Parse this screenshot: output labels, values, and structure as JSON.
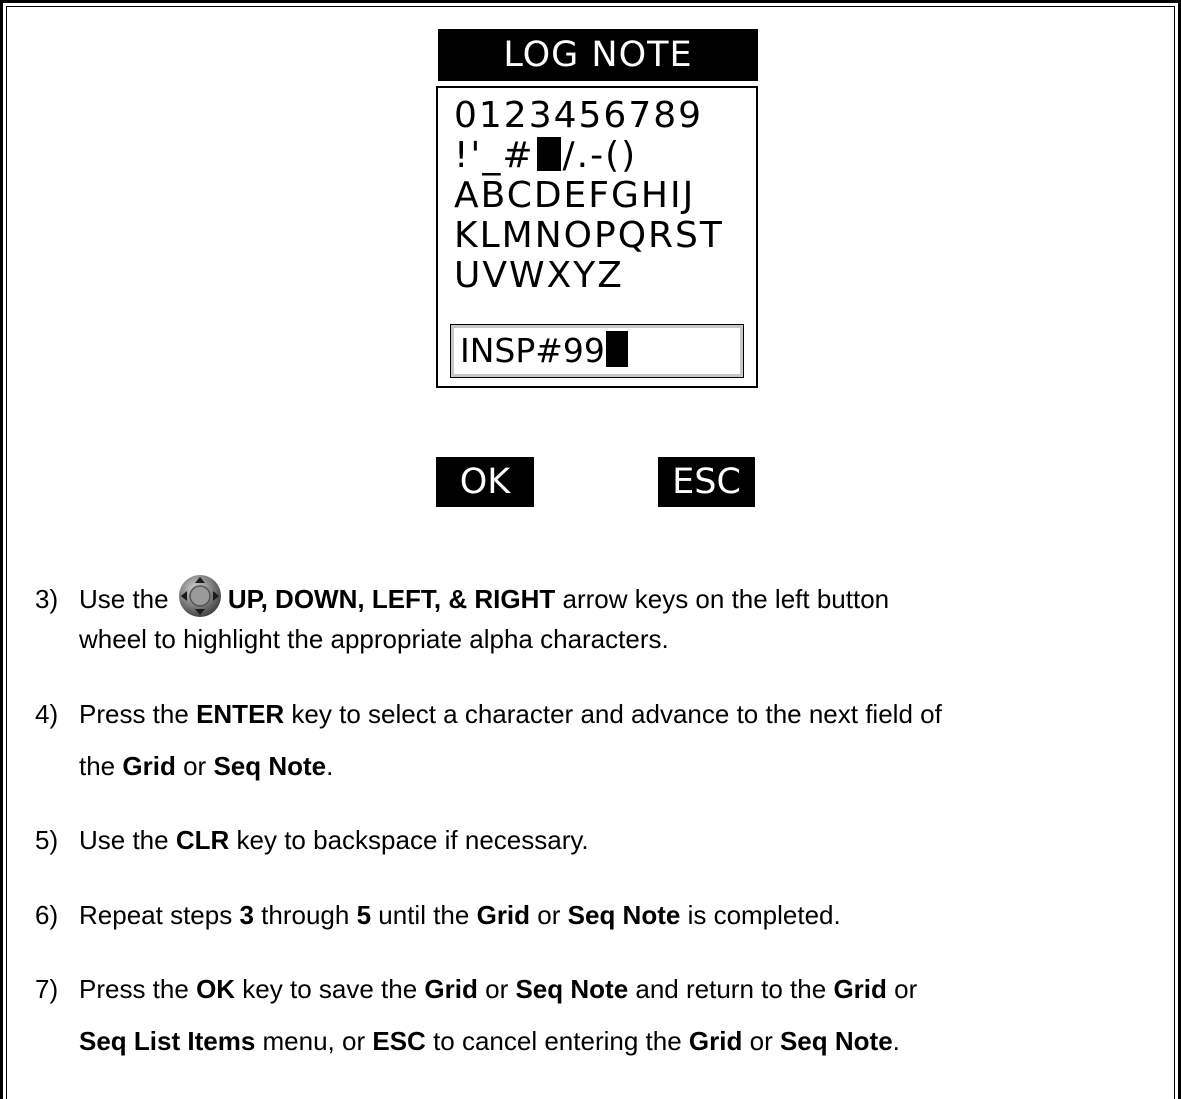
{
  "screen": {
    "title": "LOG NOTE",
    "rows": [
      "0123456789",
      "!'_#",
      "/.-()",
      "ABCDEFGHIJ",
      "KLMNOPQRST",
      "UVWXYZ"
    ],
    "note_value": "INSP#99",
    "ok_label": "OK",
    "esc_label": "ESC"
  },
  "steps": [
    {
      "num": "3)",
      "a": "Use the",
      "b": "UP, DOWN, LEFT, & RIGHT",
      "c": "arrow keys on the left button",
      "cont": "wheel to highlight the appropriate alpha characters."
    },
    {
      "num": "4)",
      "a": "Press the",
      "b": "ENTER",
      "c": "key to select a character and advance to the next field of",
      "cont_a": "the",
      "cont_b": "Grid",
      "cont_c": "or",
      "cont_d": "Seq Note",
      "cont_e": "."
    },
    {
      "num": "5)",
      "a": "Use the",
      "b": "CLR",
      "c": "key to backspace if necessary."
    },
    {
      "num": "6)",
      "a": "Repeat steps",
      "b": "3",
      "c": "through",
      "d": "5",
      "e": "until the",
      "f": "Grid",
      "g": "or",
      "h": "Seq Note",
      "i": "is completed."
    },
    {
      "num": "7)",
      "a": "Press the",
      "b": "OK",
      "c": "key to save the",
      "d": "Grid",
      "e": "or",
      "f": "Seq Note",
      "g": "and return to the",
      "h": "Grid",
      "i": "or",
      "cont_a": "Seq List Items",
      "cont_b": "menu, or",
      "cont_c": "ESC",
      "cont_d": "to cancel entering the",
      "cont_e": "Grid",
      "cont_f": "or",
      "cont_g": "Seq Note",
      "cont_h": "."
    }
  ],
  "icons": {
    "wheel": "navigation-wheel-icon"
  }
}
